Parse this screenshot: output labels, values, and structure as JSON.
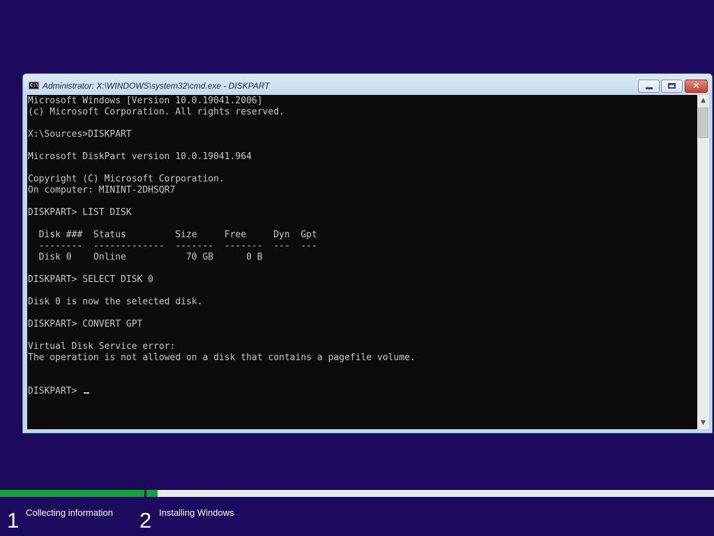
{
  "window": {
    "title": "Administrator: X:\\WINDOWS\\system32\\cmd.exe - DISKPART",
    "icon_text": "C:\\",
    "close_glyph": "✕"
  },
  "console": {
    "lines": [
      "Microsoft Windows [Version 10.0.19041.2006]",
      "(c) Microsoft Corporation. All rights reserved.",
      "",
      "X:\\Sources>DISKPART",
      "",
      "Microsoft DiskPart version 10.0.19041.964",
      "",
      "Copyright (C) Microsoft Corporation.",
      "On computer: MININT-2DHSQR7",
      "",
      "DISKPART> LIST DISK",
      "",
      "  Disk ###  Status         Size     Free     Dyn  Gpt",
      "  --------  -------------  -------  -------  ---  ---",
      "  Disk 0    Online           70 GB      0 B",
      "",
      "DISKPART> SELECT DISK 0",
      "",
      "Disk 0 is now the selected disk.",
      "",
      "DISKPART> CONVERT GPT",
      "",
      "Virtual Disk Service error:",
      "The operation is not allowed on a disk that contains a pagefile volume.",
      "",
      ""
    ],
    "prompt": "DISKPART> "
  },
  "scrollbar": {
    "up_arrow": "▲",
    "down_arrow": "▼"
  },
  "setup": {
    "steps": [
      {
        "number": "1",
        "label": "Collecting information"
      },
      {
        "number": "2",
        "label": "Installing Windows"
      }
    ]
  },
  "colors": {
    "desktop_background": "#1d0a5e",
    "progress_fill": "#12a33a",
    "console_background": "#0c0c0c",
    "console_text": "#c8c8c8"
  }
}
